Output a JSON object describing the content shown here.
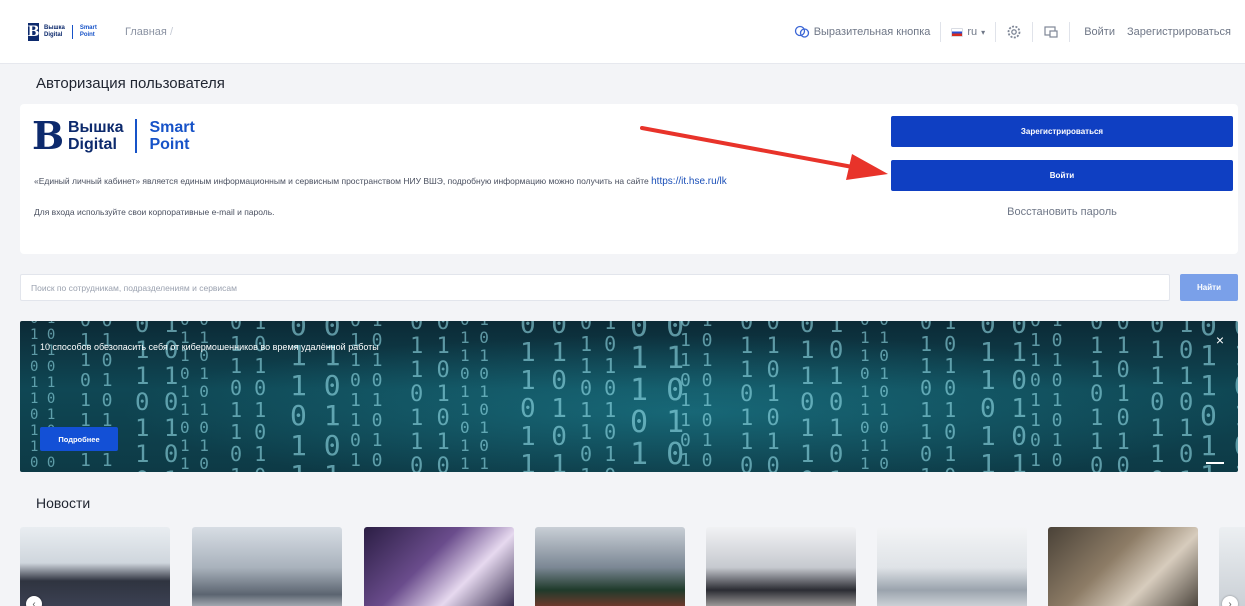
{
  "header": {
    "logo": {
      "line1": "Вышка",
      "line2": "Digital",
      "accent1": "Smart",
      "accent2": "Point"
    },
    "breadcrumb": "Главная",
    "accessibility_label": "Выразительная кнопка",
    "language": "ru",
    "login_link": "Войти",
    "register_link": "Зарегистрироваться"
  },
  "page": {
    "title": "Авторизация пользователя"
  },
  "auth": {
    "logo": {
      "line1": "Вышка",
      "line2": "Digital",
      "accent1": "Smart",
      "accent2": "Point"
    },
    "description": "«Единый личный кабинет» является единым информационным и сервисным пространством НИУ ВШЭ, подробную информацию можно получить на сайте ",
    "description_link": "https://it.hse.ru/lk",
    "hint": "Для входа используйте свои корпоративные e-mail и пароль.",
    "register_button": "Зарегистрироваться",
    "login_button": "Войти",
    "restore_link": "Восстановить пароль"
  },
  "search": {
    "placeholder": "Поиск по сотрудникам, подразделениям и сервисам",
    "button": "Найти"
  },
  "banner": {
    "text": "10 способов обезопасить себя от кибермошенников во время удалённой работы",
    "button": "Подробнее"
  },
  "news": {
    "title": "Новости",
    "cards": [
      {
        "icon": "person-photo"
      },
      {
        "icon": "winter-building-photo"
      },
      {
        "icon": "event-phone-photo"
      },
      {
        "icon": "holiday-tree-photo"
      },
      {
        "icon": "graduation-photo"
      },
      {
        "icon": "piano-room-photo"
      },
      {
        "icon": "teamwork-photo"
      }
    ]
  },
  "colors": {
    "primary": "#0f3fc2",
    "search_button": "#7aa0e9",
    "arrow": "#e8332a",
    "banner": "#0f4754"
  }
}
